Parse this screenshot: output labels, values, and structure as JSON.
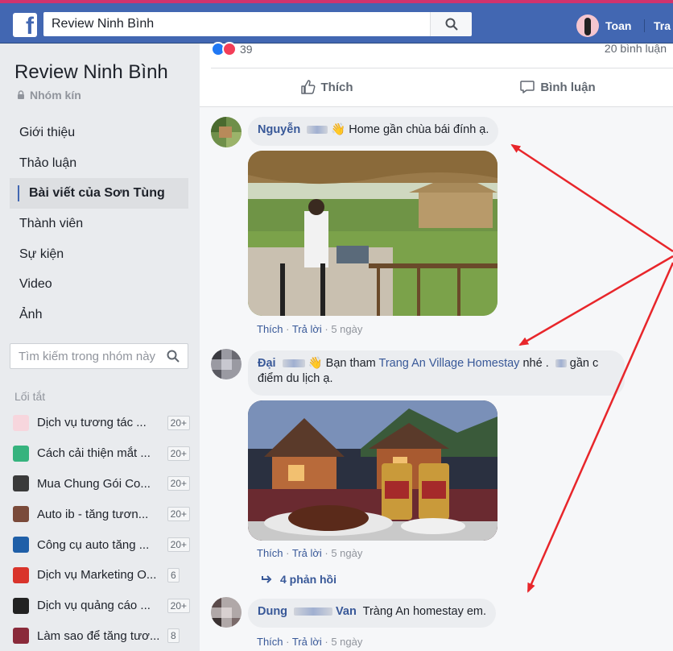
{
  "topbar": {
    "search_value": "Review Ninh Bình",
    "user_name": "Toan",
    "next_link": "Tra"
  },
  "sidebar": {
    "group_name": "Review Ninh Bình",
    "group_type": "Nhóm kín",
    "nav": [
      {
        "label": "Giới thiệu"
      },
      {
        "label": "Thảo luận"
      },
      {
        "label": "Bài viết của Sơn Tùng"
      },
      {
        "label": "Thành viên"
      },
      {
        "label": "Sự kiện"
      },
      {
        "label": "Video"
      },
      {
        "label": "Ảnh"
      }
    ],
    "search_placeholder": "Tìm kiếm trong nhóm này",
    "shortcuts_heading": "Lối tắt",
    "shortcuts": [
      {
        "label": "Dịch vụ tương tác ...",
        "count": "20+",
        "color": "#f7d6dd"
      },
      {
        "label": "Cách cải thiện mắt ...",
        "count": "20+",
        "color": "#36b37e"
      },
      {
        "label": "Mua Chung Gói Co...",
        "count": "20+",
        "color": "#3a3a3a"
      },
      {
        "label": "Auto ib - tăng tươn...",
        "count": "20+",
        "color": "#7a4a3a"
      },
      {
        "label": "Công cụ auto tăng ...",
        "count": "20+",
        "color": "#1f5fa8"
      },
      {
        "label": "Dịch vụ Marketing O...",
        "count": "6",
        "color": "#d9342b"
      },
      {
        "label": "Dịch vụ quảng cáo ...",
        "count": "20+",
        "color": "#222222"
      },
      {
        "label": "Làm sao để tăng tươ...",
        "count": "8",
        "color": "#8a2a3a"
      }
    ]
  },
  "post": {
    "reaction_count": "39",
    "comment_count": "20 bình luận",
    "like_label": "Thích",
    "comment_label": "Bình luận"
  },
  "comments": [
    {
      "name": "Nguyễn",
      "text": "Home gần chùa bái đính ạ.",
      "like": "Thích",
      "reply": "Trả lời",
      "time": "5 ngày"
    },
    {
      "name": "Đại",
      "text_before": "Bạn tham",
      "link": "Trang An Village Homestay",
      "text_after": "nhé . ",
      "text_after2": "gần c",
      "text_line2": "điểm du lịch ạ.",
      "like": "Thích",
      "reply": "Trả lời",
      "time": "5 ngày",
      "replies": "4 phản hồi"
    },
    {
      "name": "Dung",
      "name_end": "Van",
      "text": "Tràng An homestay em.",
      "like": "Thích",
      "reply": "Trả lời",
      "time": "5 ngày"
    }
  ],
  "annotation_color": "#e8262b"
}
